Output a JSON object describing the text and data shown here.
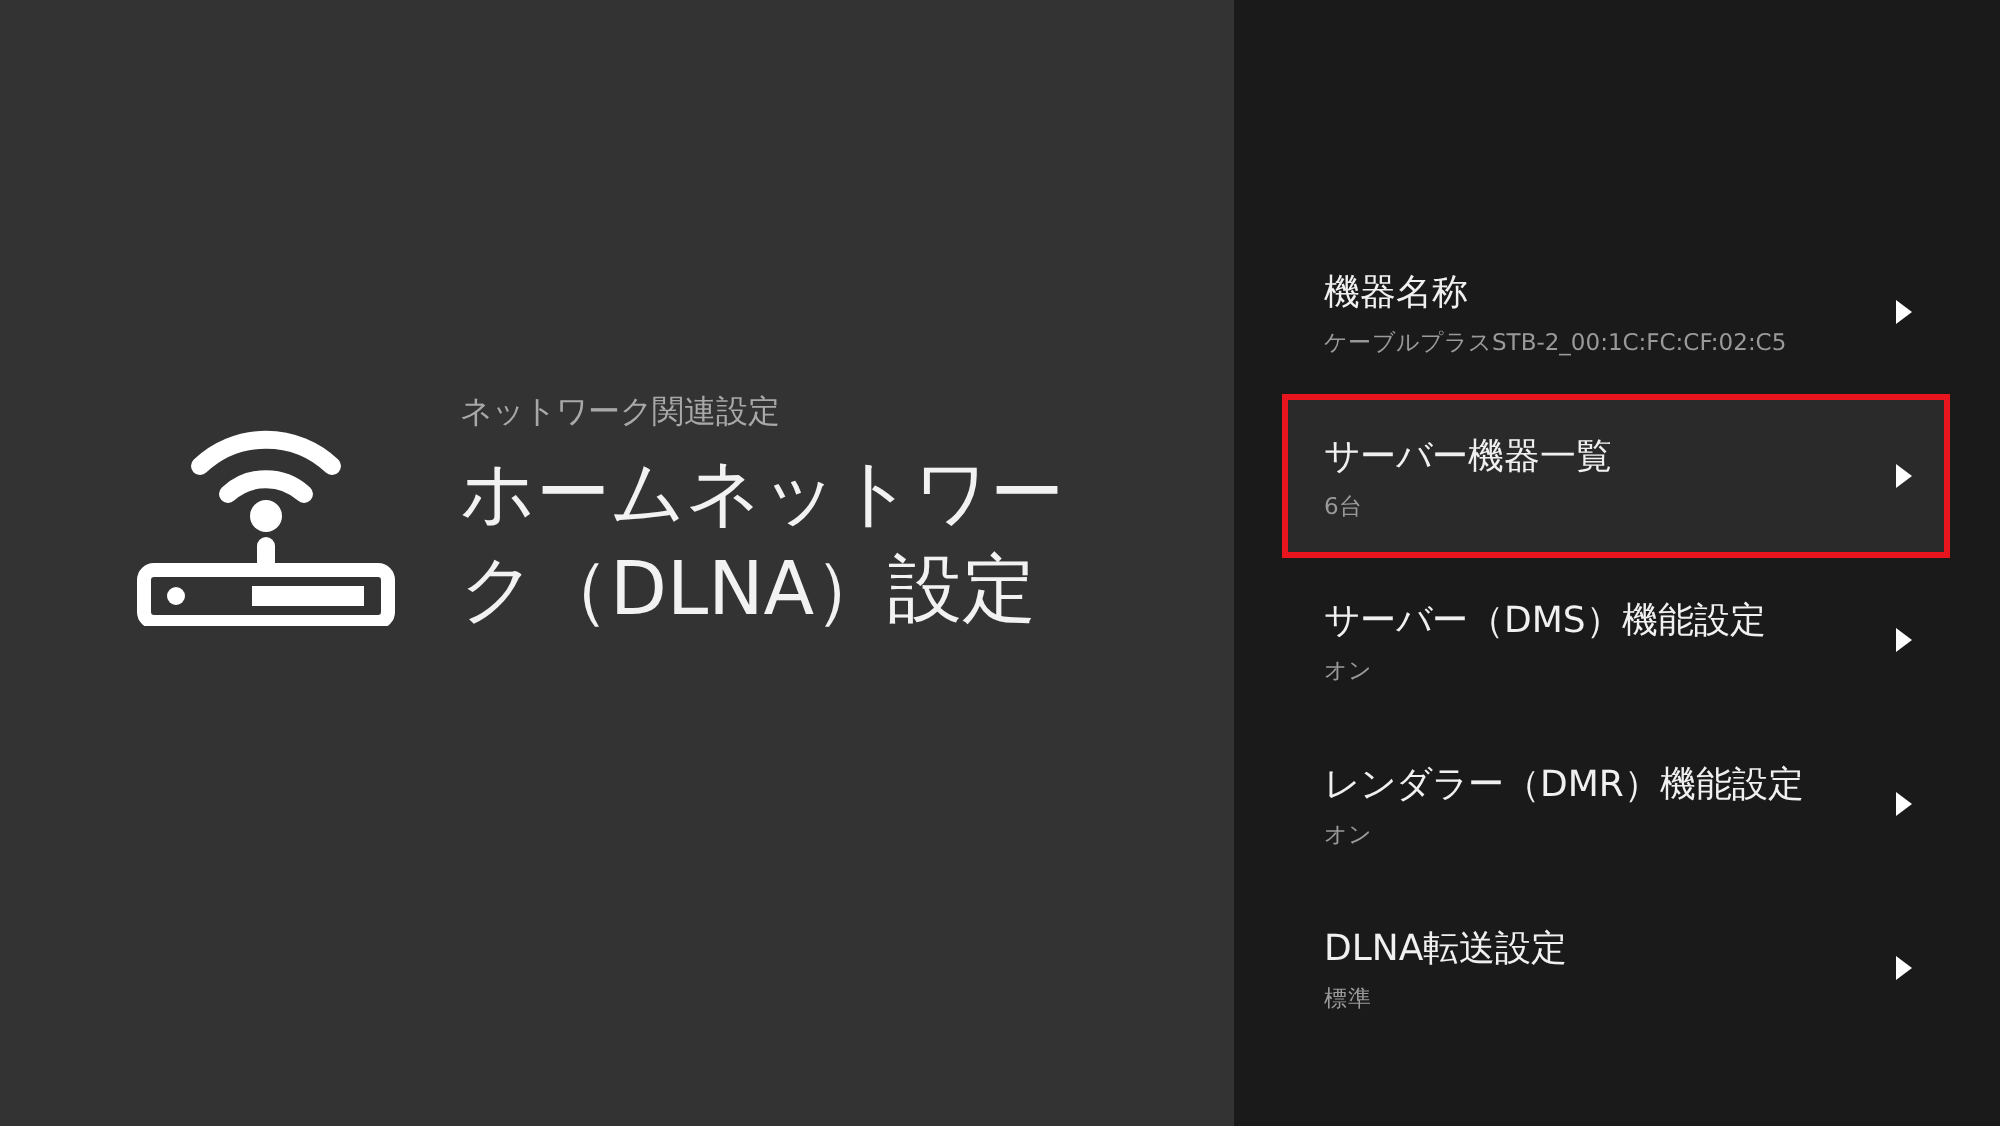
{
  "header": {
    "breadcrumb": "ネットワーク関連設定",
    "title": "ホームネットワーク（DLNA）設定"
  },
  "menu": [
    {
      "label": "機器名称",
      "value": "ケーブルプラスSTB-2_00:1C:FC:CF:02:C5",
      "selected": false
    },
    {
      "label": "サーバー機器一覧",
      "value": "6台",
      "selected": true
    },
    {
      "label": "サーバー（DMS）機能設定",
      "value": "オン",
      "selected": false
    },
    {
      "label": "レンダラー（DMR）機能設定",
      "value": "オン",
      "selected": false
    },
    {
      "label": "DLNA転送設定",
      "value": "標準",
      "selected": false
    }
  ]
}
